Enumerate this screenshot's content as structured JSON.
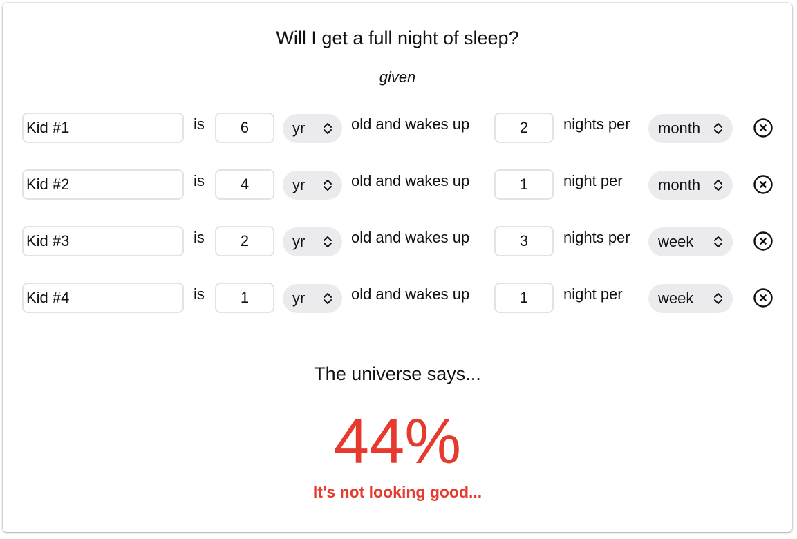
{
  "header": {
    "title": "Will I get a full night of sleep?",
    "subtitle": "given"
  },
  "row_words": {
    "is": "is",
    "old_wakes": "old and wakes up"
  },
  "kids": [
    {
      "name": "Kid #1",
      "age": "6",
      "age_unit": "yr",
      "wakes": "2",
      "nights_label": "nights per",
      "period": "month"
    },
    {
      "name": "Kid #2",
      "age": "4",
      "age_unit": "yr",
      "wakes": "1",
      "nights_label": "night per",
      "period": "month"
    },
    {
      "name": "Kid #3",
      "age": "2",
      "age_unit": "yr",
      "wakes": "3",
      "nights_label": "nights per",
      "period": "week"
    },
    {
      "name": "Kid #4",
      "age": "1",
      "age_unit": "yr",
      "wakes": "1",
      "nights_label": "night per",
      "period": "week"
    }
  ],
  "result": {
    "heading": "The universe says...",
    "percent": "44%",
    "verdict": "It's not looking good..."
  },
  "colors": {
    "accent_red": "#e63a2e",
    "pill_bg": "#ebebee",
    "field_border": "#e3e3e6"
  },
  "icons": {
    "remove": "x-circle-icon",
    "select": "chevron-up-down-icon"
  }
}
